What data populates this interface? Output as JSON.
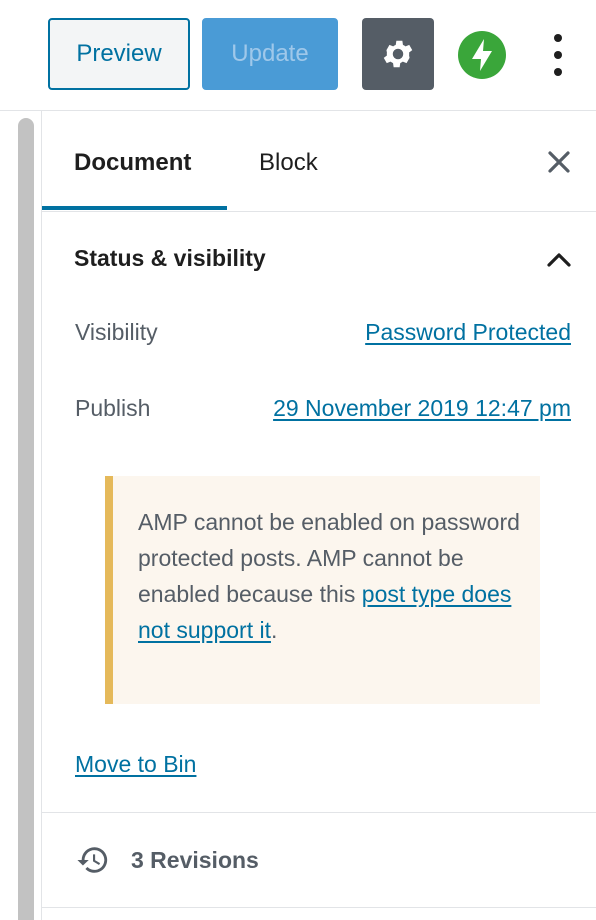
{
  "toolbar": {
    "preview_label": "Preview",
    "update_label": "Update",
    "settings_icon": "gear-icon",
    "jetpack_icon": "jetpack-bolt-icon",
    "more_icon": "vertical-ellipsis-icon"
  },
  "sidebar": {
    "tabs": [
      {
        "label": "Document",
        "active": true
      },
      {
        "label": "Block",
        "active": false
      }
    ],
    "close_icon": "close-icon",
    "status_panel": {
      "title": "Status & visibility",
      "visibility_label": "Visibility",
      "visibility_value": "Password Protected",
      "publish_label": "Publish",
      "publish_value": "29 November 2019 12:47 pm",
      "notice": {
        "line1": "AMP cannot be enabled on password protected posts. AMP cannot be enabled because this ",
        "link": "post type does not support it",
        "end": "."
      },
      "move_to_bin": "Move to Bin"
    },
    "revisions": {
      "label": "3 Revisions",
      "icon": "history-icon"
    }
  },
  "colors": {
    "accent": "#0071a1",
    "update_bg": "#4a9bd6",
    "settings_bg": "#555d66",
    "jetpack_green": "#3aa63a",
    "notice_border": "#e5b95a",
    "notice_bg": "#fcf6ee"
  }
}
